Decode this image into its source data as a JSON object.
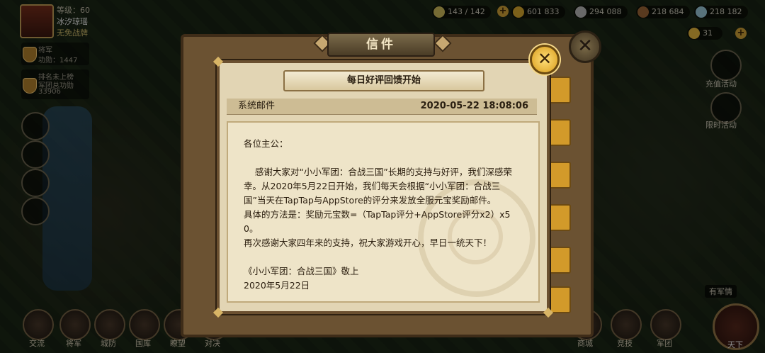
{
  "player": {
    "level": "等级：60",
    "name": "冰汐琼瑶",
    "status": "无免战牌",
    "rank_label": "将军",
    "rank_merit": "功勋：1447",
    "rank2_label": "排名未上榜",
    "rank2_sub": "军团总功勋",
    "rank2_value": "33906"
  },
  "resources": [
    {
      "value": "143 / 142",
      "color": "#d8c460"
    },
    {
      "value": "601 833",
      "color": "#e0b030"
    },
    {
      "value": "294 088",
      "color": "#c0c0c0"
    },
    {
      "value": "218 684",
      "color": "#a36a3a"
    },
    {
      "value": "218 182",
      "color": "#a0d0e0"
    }
  ],
  "gold": "31",
  "right_menu": {
    "recharge": "充值活动",
    "limited": "限时活动",
    "tooltip": "有军情"
  },
  "nav": [
    "交流",
    "将军",
    "城防",
    "国库",
    "瞭望",
    "对决",
    "商城",
    "竞技",
    "军团",
    "天下"
  ],
  "dialog": {
    "title": "信件",
    "close_icon": "✕"
  },
  "letter": {
    "title": "每日好评回馈开始",
    "from": "系统邮件",
    "date": "2020-05-22 18:08:06",
    "lines": [
      "各位主公：",
      "",
      "    感谢大家对“小小军团：合战三国”长期的支持与好评，我们深感荣幸。从2020年5月22日开始，我们每天会根据“小小军团：合战三国”当天在TapTap与AppStore的评分来发放全服元宝奖励邮件。",
      "具体的方法是：奖励元宝数=（TapTap评分+AppStore评分x2）x50。",
      "再次感谢大家四年来的支持，祝大家游戏开心，早日一统天下！",
      "",
      "《小小军团：合战三国》敬上",
      "2020年5月22日"
    ]
  }
}
